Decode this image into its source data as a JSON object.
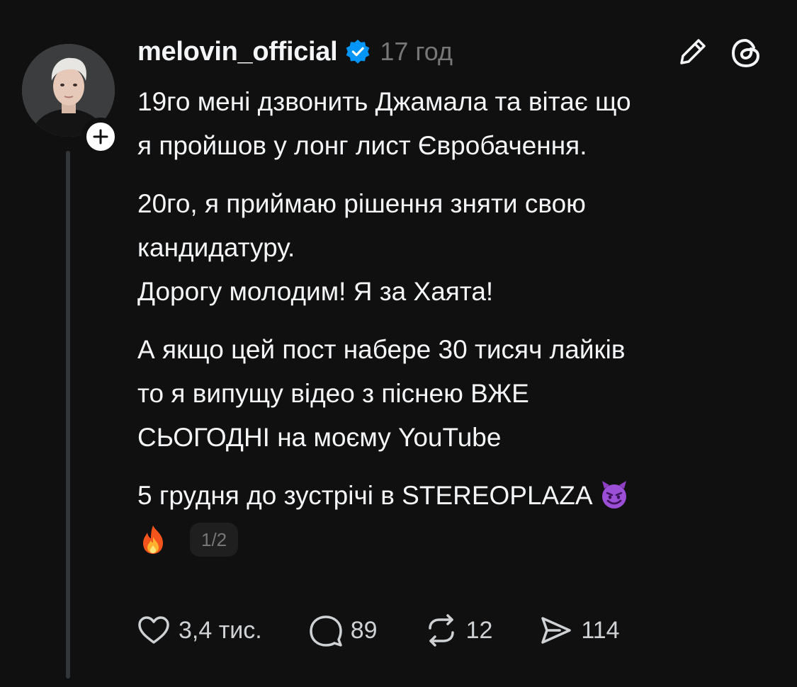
{
  "post": {
    "author": {
      "username": "melovin_official",
      "verified": true,
      "avatar_icon": "profile-photo"
    },
    "timestamp": "17 год",
    "paragraphs": [
      {
        "lines": [
          "19го мені дзвонить Джамала та вітає що",
          "я пройшов у лонг лист Євробачення."
        ]
      },
      {
        "lines": [
          "20го, я приймаю рішення зняти свою",
          "кандидатуру."
        ]
      },
      {
        "lines": [
          "Дорогу молодим! Я за Хаята!"
        ]
      },
      {
        "lines": [
          "А якщо цей пост набере 30 тисяч лайків",
          "то я випущу відео з піснею ВЖЕ",
          "СЬОГОДНІ на моєму YouTube"
        ]
      },
      {
        "lines": [
          "5 грудня до зустрічі в STEREOPLAZA"
        ],
        "emojis": [
          "smiling-devil-emoji",
          "fire-emoji"
        ]
      }
    ],
    "page_indicator": "1/2",
    "stats": {
      "likes": "3,4 тис.",
      "comments": "89",
      "reposts": "12",
      "shares": "114"
    }
  },
  "icons": {
    "verified": "verified-badge-icon",
    "edit": "pencil-icon",
    "app": "threads-logo-icon",
    "follow": "plus-icon",
    "like": "heart-icon",
    "comment": "speech-bubble-icon",
    "repost": "repost-icon",
    "share": "send-icon"
  },
  "colors": {
    "background": "#101010",
    "text": "#f3f5f7",
    "muted": "#777777",
    "verified": "#0095f6",
    "badge_bg": "#1f1f1f",
    "thread_line": "#333638"
  }
}
